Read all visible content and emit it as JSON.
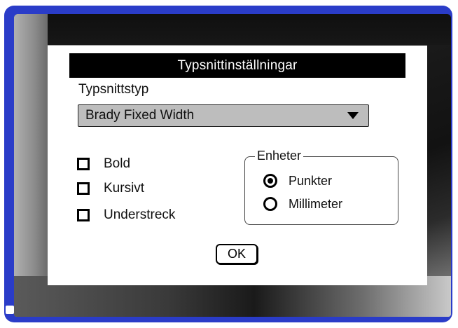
{
  "dialog": {
    "title": "Typsnittinställningar",
    "font_type_label": "Typsnittstyp",
    "font_type_value": "Brady Fixed Width",
    "styles": [
      {
        "label": "Bold",
        "checked": false
      },
      {
        "label": "Kursivt",
        "checked": false
      },
      {
        "label": "Understreck",
        "checked": false
      }
    ],
    "units": {
      "legend": "Enheter",
      "options": [
        {
          "label": "Punkter",
          "selected": true
        },
        {
          "label": "Millimeter",
          "selected": false
        }
      ]
    },
    "ok_label": "OK"
  },
  "colors": {
    "bezel": "#2a3cc8",
    "title_bar": "#000000",
    "dropdown": "#bdbdbd"
  },
  "icons": {
    "dropdown": "triangle-down-icon",
    "checkbox": "checkbox-unchecked-icon",
    "radio_on": "radio-checked-icon",
    "radio_off": "radio-unchecked-icon"
  }
}
